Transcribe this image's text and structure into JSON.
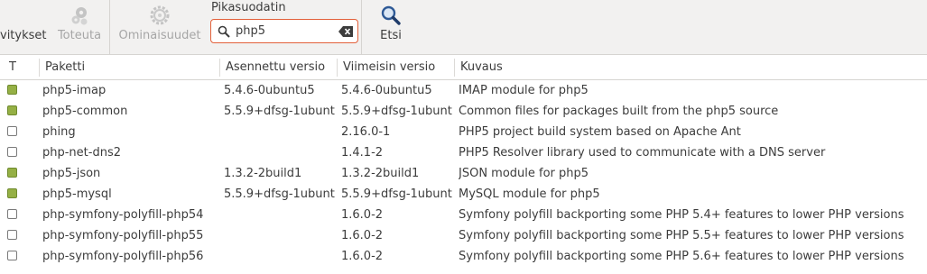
{
  "toolbar": {
    "partial_button_label": "vitykset",
    "apply_label": "Toteuta",
    "properties_label": "Ominaisuudet",
    "quick_filter_label": "Pikasuodatin",
    "search_value": "php5",
    "search_button_label": "Etsi",
    "accent": "#e2603a"
  },
  "table": {
    "headers": {
      "status": "T",
      "package": "Paketti",
      "installed": "Asennettu versio",
      "latest": "Viimeisin versio",
      "description": "Kuvaus"
    },
    "rows": [
      {
        "installed_state": true,
        "package": "php5-imap",
        "installed": "5.4.6-0ubuntu5",
        "latest": "5.4.6-0ubuntu5",
        "description": "IMAP module for php5"
      },
      {
        "installed_state": true,
        "package": "php5-common",
        "installed": "5.5.9+dfsg-1ubuntu",
        "latest": "5.5.9+dfsg-1ubuntu",
        "description": "Common files for packages built from the php5 source"
      },
      {
        "installed_state": false,
        "package": "phing",
        "installed": "",
        "latest": "2.16.0-1",
        "description": "PHP5 project build system based on Apache Ant"
      },
      {
        "installed_state": false,
        "package": "php-net-dns2",
        "installed": "",
        "latest": "1.4.1-2",
        "description": "PHP5 Resolver library used to communicate with a DNS server"
      },
      {
        "installed_state": true,
        "package": "php5-json",
        "installed": "1.3.2-2build1",
        "latest": "1.3.2-2build1",
        "description": "JSON module for php5"
      },
      {
        "installed_state": true,
        "package": "php5-mysql",
        "installed": "5.5.9+dfsg-1ubuntu",
        "latest": "5.5.9+dfsg-1ubuntu",
        "description": "MySQL module for php5"
      },
      {
        "installed_state": false,
        "package": "php-symfony-polyfill-php54",
        "installed": "",
        "latest": "1.6.0-2",
        "description": "Symfony polyfill backporting some PHP 5.4+ features to lower PHP versions"
      },
      {
        "installed_state": false,
        "package": "php-symfony-polyfill-php55",
        "installed": "",
        "latest": "1.6.0-2",
        "description": "Symfony polyfill backporting some PHP 5.5+ features to lower PHP versions"
      },
      {
        "installed_state": false,
        "package": "php-symfony-polyfill-php56",
        "installed": "",
        "latest": "1.6.0-2",
        "description": "Symfony polyfill backporting some PHP 5.6+ features to lower PHP versions"
      }
    ]
  }
}
